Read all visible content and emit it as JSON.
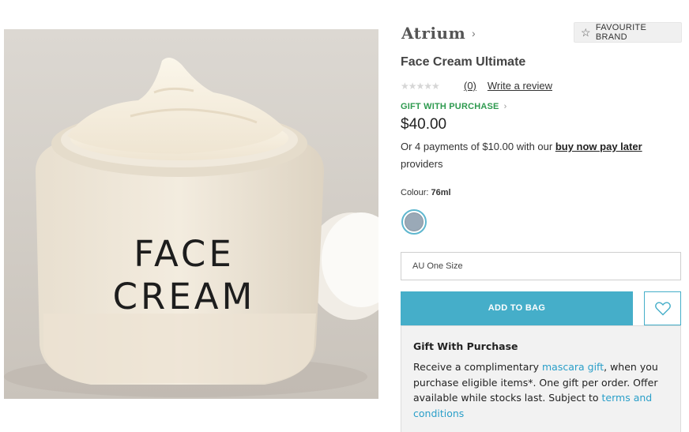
{
  "product_image": {
    "alt_text": "FACE CREAM",
    "jar_label_line1": "FACE",
    "jar_label_line2": "CREAM"
  },
  "brand": {
    "name": "Atrium",
    "chevron": "›",
    "favourite_label": "FAVOURITE BRAND"
  },
  "product": {
    "title": "Face Cream Ultimate",
    "rating_stars": "★★★★★",
    "review_count": "(0)",
    "write_review_label": "Write a review",
    "gwp_link_label": "GIFT WITH PURCHASE",
    "price": "$40.00",
    "payments_prefix": "Or 4 payments of $10.00 with our ",
    "payments_link": "buy now pay later",
    "payments_suffix": " providers"
  },
  "colour": {
    "label": "Colour:",
    "selected": "76ml",
    "swatch_color": "#9aa9b7"
  },
  "size_select": {
    "value": "AU One Size"
  },
  "actions": {
    "add_to_bag_label": "ADD TO BAG"
  },
  "gift": {
    "title": "Gift With Purchase",
    "text_1": "Receive a complimentary ",
    "link_1": "mascara gift",
    "text_2": ", when you purchase eligible items*. One gift per order. Offer available while stocks last. Subject to ",
    "link_2": "terms and conditions"
  },
  "colors": {
    "accent": "#45aec9",
    "gwp_green": "#2e9a4f",
    "link_blue": "#2a9fc9"
  }
}
